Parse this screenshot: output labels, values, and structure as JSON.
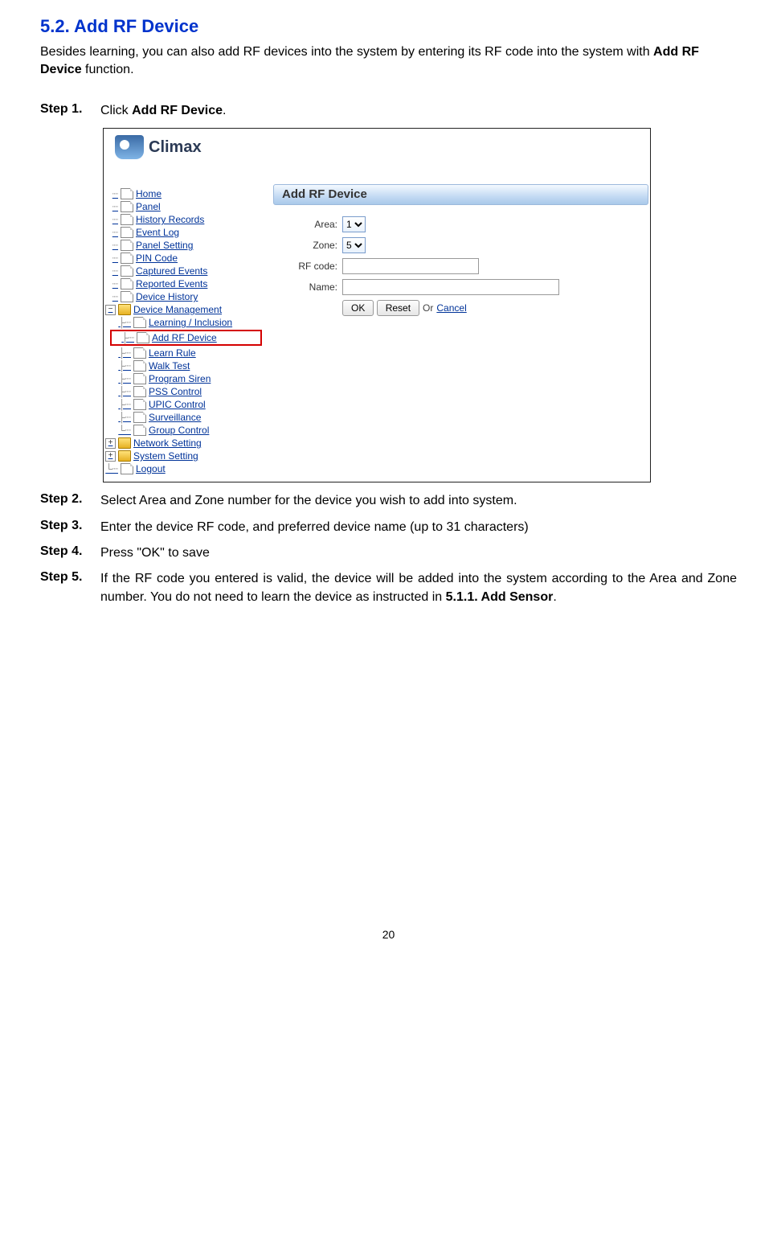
{
  "section": {
    "title": "5.2. Add RF Device",
    "intro_pre": "Besides learning, you can also add RF devices into the system by entering its RF code into the system with ",
    "intro_bold": "Add RF Device",
    "intro_post": " function."
  },
  "steps": {
    "s1": {
      "label": "Step 1.",
      "pre": "Click ",
      "bold": "Add RF Device",
      "post": "."
    },
    "s2": {
      "label": "Step 2.",
      "text": "Select Area and Zone number for the device you wish to add into system."
    },
    "s3": {
      "label": "Step 3.",
      "text": "Enter the device RF code, and preferred device name (up to 31 characters)"
    },
    "s4": {
      "label": "Step 4.",
      "text": "Press \"OK\" to save"
    },
    "s5": {
      "label": "Step 5.",
      "pre": "If the RF code you entered is valid, the device will be added into the system according to the Area and Zone number. You do not need to learn the device as instructed in ",
      "bold": "5.1.1. Add Sensor",
      "post": "."
    }
  },
  "screenshot": {
    "logo_text": "Climax",
    "tree": {
      "home": "Home",
      "panel": "Panel",
      "history": "History Records",
      "eventlog": "Event Log",
      "panelsetting": "Panel Setting",
      "pincode": "PIN Code",
      "captured": "Captured Events",
      "reported": "Reported Events",
      "devhistory": "Device History",
      "devmgmt": "Device Management",
      "learning": "Learning / Inclusion",
      "addrf": "Add RF Device",
      "learnrule": "Learn Rule",
      "walktest": "Walk Test",
      "programsiren": "Program Siren",
      "psscontrol": "PSS Control",
      "upiccontrol": "UPIC Control",
      "surveillance": "Surveillance",
      "groupcontrol": "Group Control",
      "network": "Network Setting",
      "system": "System Setting",
      "logout": "Logout"
    },
    "form": {
      "title": "Add RF Device",
      "area_label": "Area:",
      "area_value": "1",
      "zone_label": "Zone:",
      "zone_value": "5",
      "rfcode_label": "RF code:",
      "rfcode_value": "",
      "name_label": "Name:",
      "name_value": "",
      "ok": "OK",
      "reset": "Reset",
      "or": "Or",
      "cancel": "Cancel"
    }
  },
  "page_number": "20"
}
